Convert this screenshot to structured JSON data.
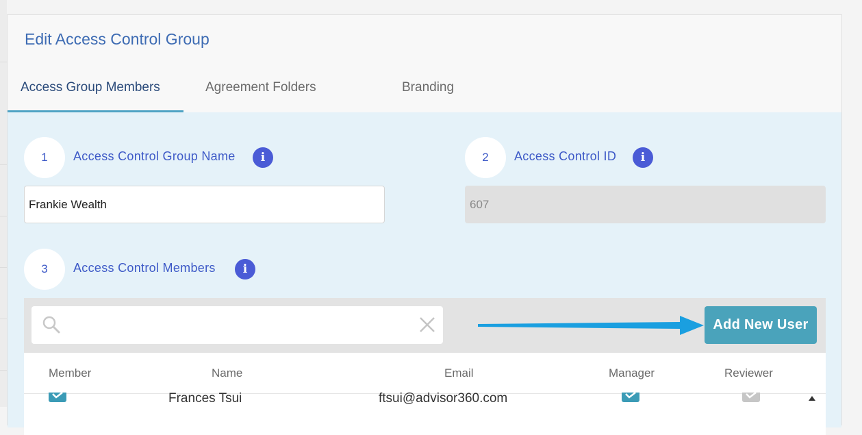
{
  "modal": {
    "title": "Edit Access Control Group"
  },
  "tabs": [
    {
      "label": "Access Group Members",
      "active": true
    },
    {
      "label": "Agreement Folders",
      "active": false
    },
    {
      "label": "Branding",
      "active": false
    }
  ],
  "steps": [
    {
      "number": "1",
      "label": "Access Control Group Name"
    },
    {
      "number": "2",
      "label": "Access Control ID"
    },
    {
      "number": "3",
      "label": "Access Control Members"
    }
  ],
  "fields": {
    "group_name_value": "Frankie Wealth",
    "access_control_id_value": "607"
  },
  "search": {
    "placeholder": ""
  },
  "add_button": {
    "label": "Add New User"
  },
  "table": {
    "columns": [
      "Member",
      "Name",
      "Email",
      "Manager",
      "Reviewer"
    ],
    "rows": [
      {
        "member": true,
        "name": "Frances Tsui",
        "email": "ftsui@advisor360.com",
        "manager": true,
        "reviewer": false
      }
    ]
  },
  "colors": {
    "accent": "#4aa3bb",
    "title": "#3d6bb3",
    "step_text": "#3d59c7",
    "info_icon": "#4a5bd6",
    "arrow": "#1a9fe0"
  },
  "icons": [
    "info-icon",
    "search-icon",
    "close-icon",
    "arrow-right-icon",
    "checkmark-icon",
    "scroll-up-icon"
  ]
}
